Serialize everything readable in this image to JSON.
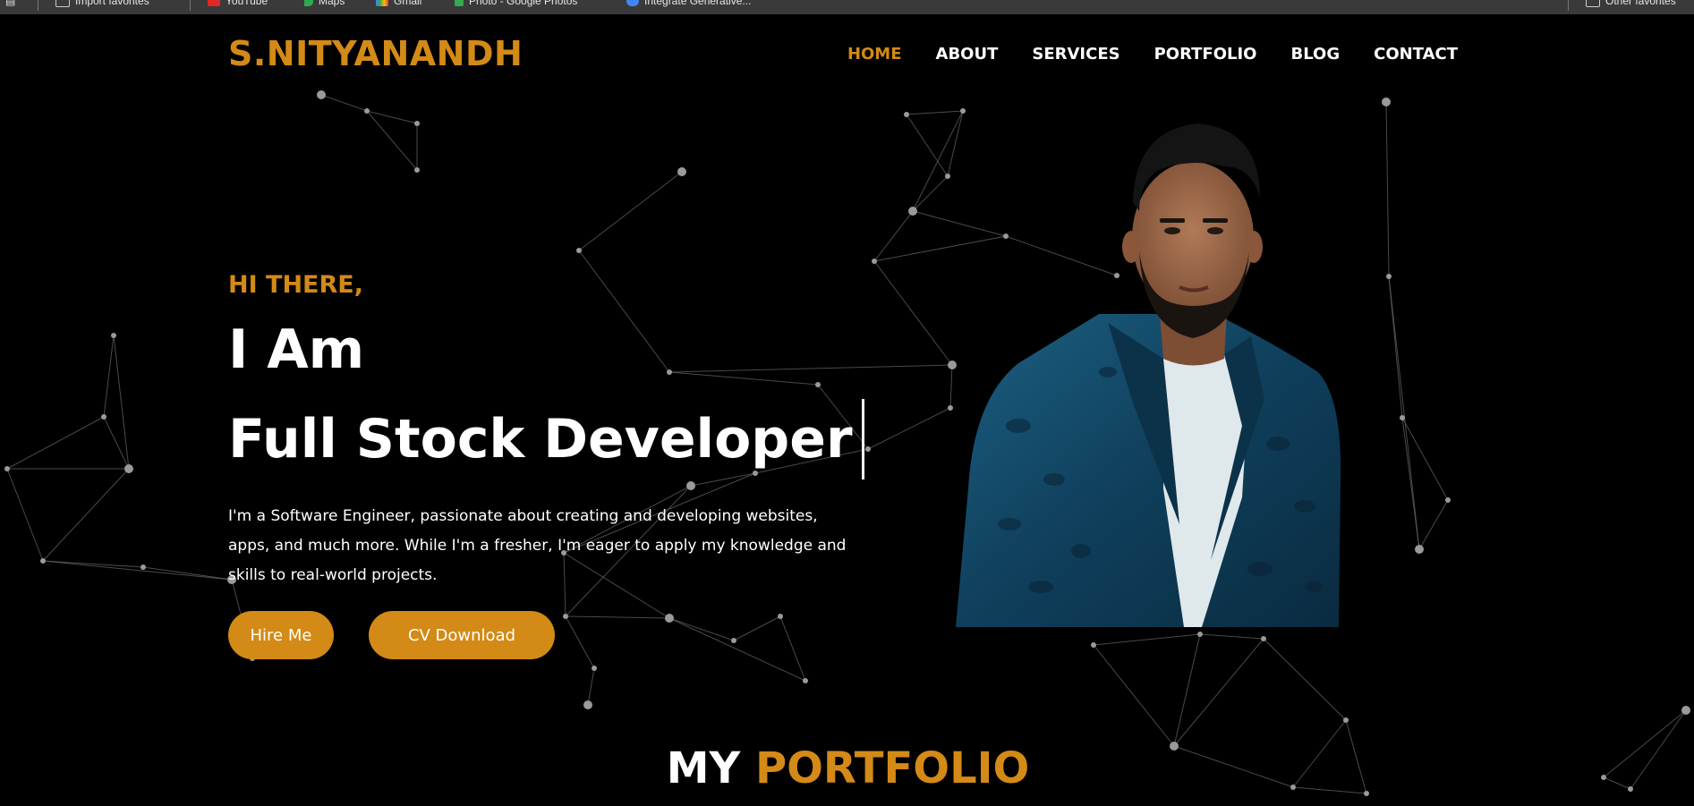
{
  "browser": {
    "favorites": [
      {
        "label": "Import favorites",
        "icon": "import-icon"
      },
      {
        "label": "YouTube",
        "icon": "youtube-icon"
      },
      {
        "label": "Maps",
        "icon": "maps-icon"
      },
      {
        "label": "Gmail",
        "icon": "gmail-icon"
      },
      {
        "label": "Photo - Google Photos",
        "icon": "photos-icon"
      },
      {
        "label": "Integrate Generative...",
        "icon": "integrate-icon"
      },
      {
        "label": "Other favorites",
        "icon": "folder-icon"
      }
    ]
  },
  "site": {
    "logo": "S.NITYANANDH",
    "nav": [
      {
        "label": "HOME",
        "active": true
      },
      {
        "label": "ABOUT",
        "active": false
      },
      {
        "label": "SERVICES",
        "active": false
      },
      {
        "label": "PORTFOLIO",
        "active": false
      },
      {
        "label": "BLOG",
        "active": false
      },
      {
        "label": "CONTACT",
        "active": false
      }
    ]
  },
  "hero": {
    "greeting": "HI THERE,",
    "intro": "I Am",
    "role": "Full Stock Developer",
    "description": "I'm a Software Engineer, passionate about creating and developing websites, apps, and much more. While I'm a fresher, I'm eager to apply my knowledge and skills to real-world projects.",
    "hire_button": "Hire Me",
    "cv_button": "CV Download"
  },
  "portfolio": {
    "title_part1": "MY",
    "title_part2": "PORTFOLIO"
  },
  "colors": {
    "accent": "#d38a16",
    "background": "#000000",
    "text": "#ffffff"
  }
}
